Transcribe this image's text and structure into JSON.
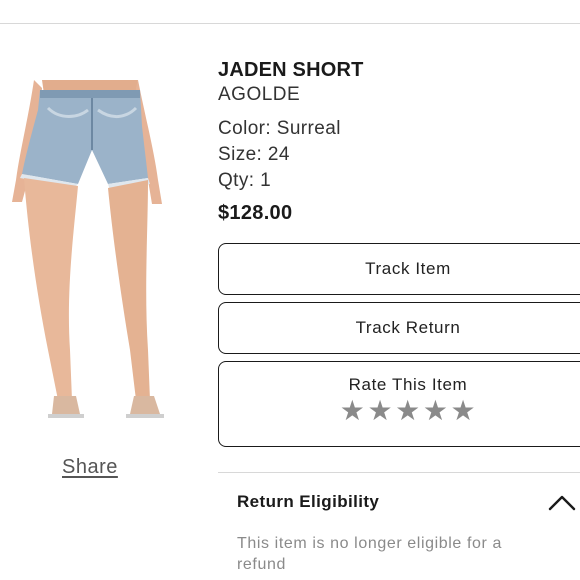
{
  "product": {
    "name": "JADEN SHORT",
    "brand": "AGOLDE",
    "color": "Color: Surreal",
    "size": "Size: 24",
    "qty": "Qty: 1",
    "price": "$128.00"
  },
  "actions": {
    "track_item": "Track Item",
    "track_return": "Track Return",
    "rate_item": "Rate This Item",
    "rating_stars": 5
  },
  "share": {
    "label": "Share"
  },
  "return_eligibility": {
    "title": "Return Eligibility",
    "message": "This item is no longer eligible for a refund"
  },
  "colors": {
    "text": "#1a1a1a",
    "muted": "#8a8a8a",
    "denim": "#9bb3c9",
    "skin": "#e8b89a"
  }
}
